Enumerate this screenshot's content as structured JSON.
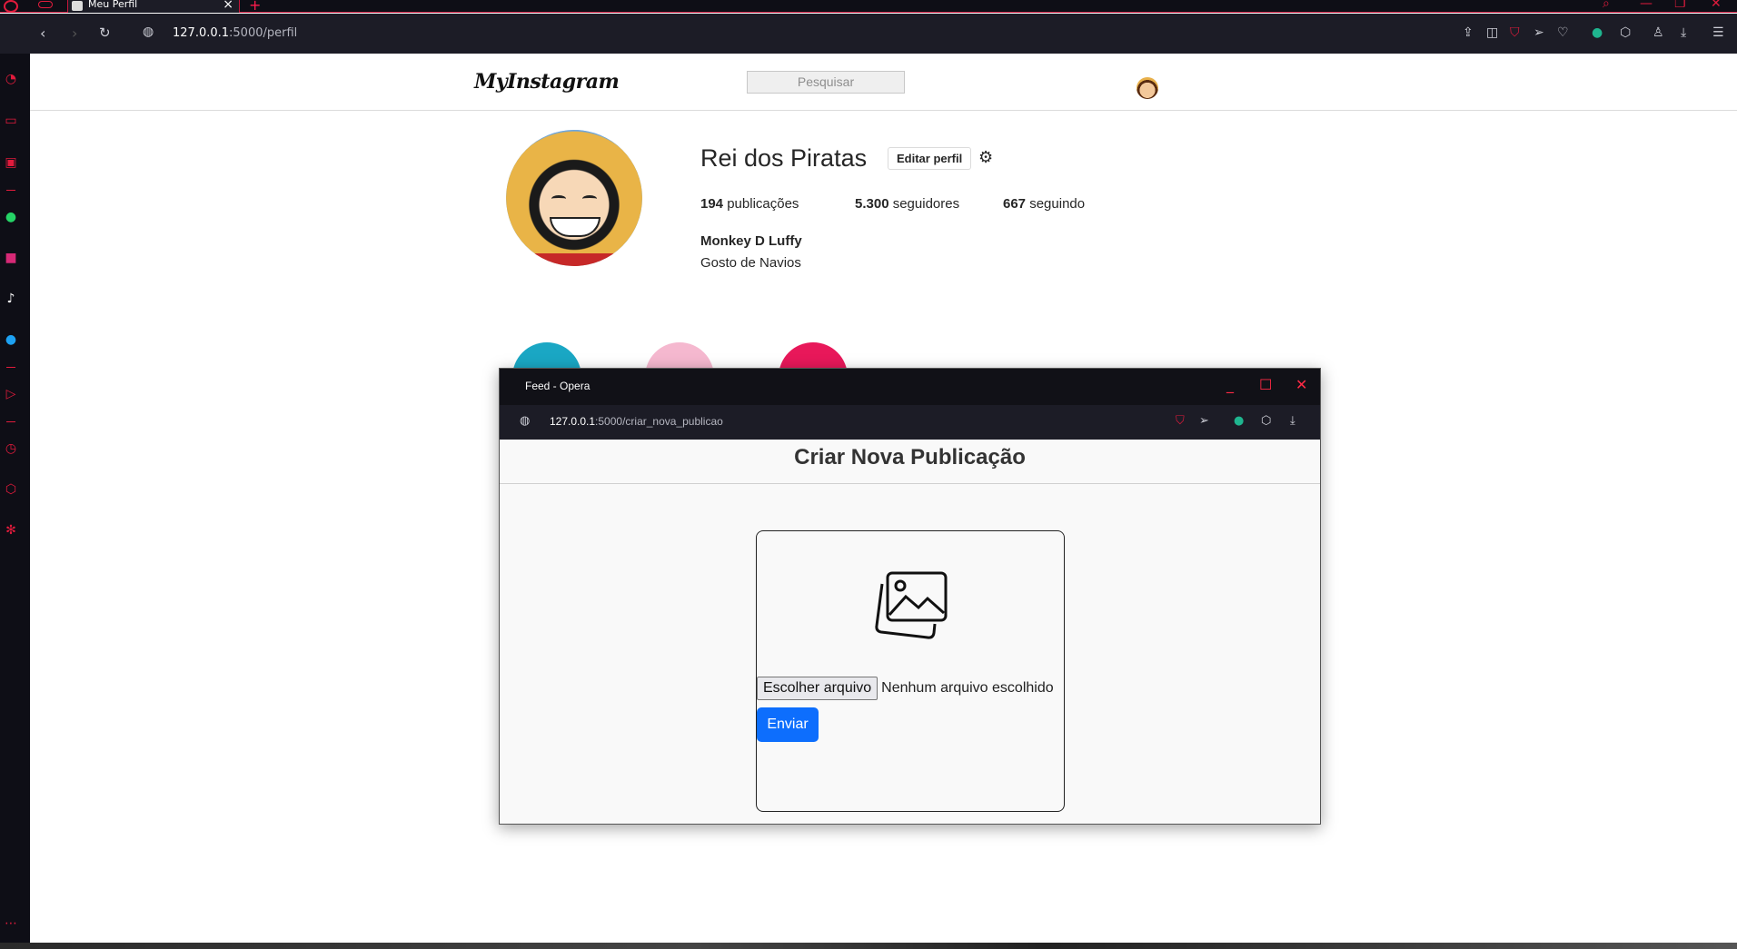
{
  "browser": {
    "tab_title": "Meu Perfil",
    "url_host": "127.0.0.1",
    "url_path": ":5000/perfil"
  },
  "instagram": {
    "logo": "MyInstagram",
    "search_placeholder": "Pesquisar",
    "username": "Rei dos Piratas",
    "edit_profile_label": "Editar perfil",
    "stats": {
      "posts_count": "194",
      "posts_label": "publicações",
      "followers_count": "5.300",
      "followers_label": "seguidores",
      "following_count": "667",
      "following_label": "seguindo"
    },
    "full_name": "Monkey D Luffy",
    "bio": "Gosto de Navios",
    "highlight_colors": [
      "#1aa7c4",
      "#f5b8cf",
      "#e8185a"
    ]
  },
  "popup": {
    "window_title": "Feed - Opera",
    "url_host": "127.0.0.1",
    "url_path": ":5000/criar_nova_publicao",
    "heading": "Criar Nova Publicação",
    "file_button_label": "Escolher arquivo",
    "file_status": "Nenhum arquivo escolhido",
    "submit_label": "Enviar"
  },
  "colors": {
    "opera_accent": "#e11b3c",
    "primary_button": "#0d6efd"
  }
}
